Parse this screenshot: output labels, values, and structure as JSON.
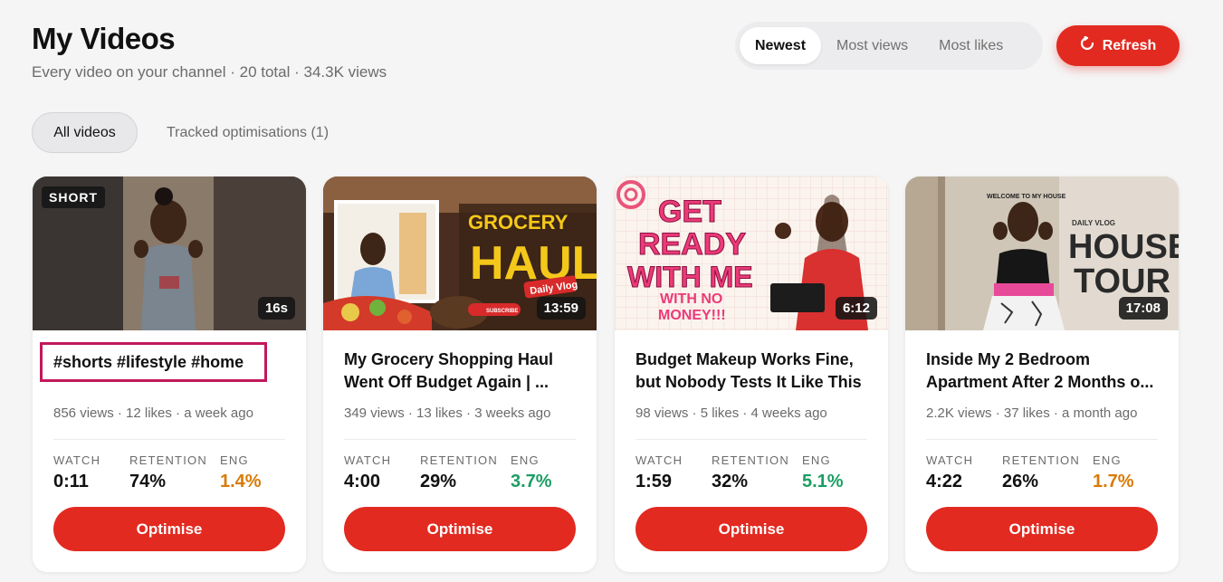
{
  "header": {
    "title": "My Videos",
    "subtitle": "Every video on your channel · 20 total · 34.3K views"
  },
  "sort": {
    "options": [
      "Newest",
      "Most views",
      "Most likes"
    ],
    "selected": "Newest"
  },
  "refresh": {
    "label": "Refresh",
    "icon": "refresh-icon"
  },
  "tabs": [
    {
      "label": "All videos",
      "active": true
    },
    {
      "label": "Tracked optimisations (1)",
      "active": false
    }
  ],
  "stat_labels": {
    "watch": "WATCH",
    "retention": "RETENTION",
    "eng": "ENG"
  },
  "colors": {
    "accent": "#e22a20",
    "eng_orange": "#d97a06",
    "eng_green": "#1a9e63",
    "highlight_border": "#c2185b"
  },
  "videos": [
    {
      "badge": "SHORT",
      "duration": "16s",
      "title": "#shorts #lifestyle #home",
      "meta": "856 views · 12 likes · a week ago",
      "watch": "0:11",
      "retention": "74%",
      "eng": "1.4%",
      "eng_color": "orange",
      "action": "Optimise"
    },
    {
      "badge": "",
      "thumb_text": [
        "GROCERY",
        "HAUL",
        "Daily Vlog",
        "SUBSCRIBE"
      ],
      "duration": "13:59",
      "title": "My Grocery Shopping Haul Went Off Budget Again | ...",
      "meta": "349 views · 13 likes · 3 weeks ago",
      "watch": "4:00",
      "retention": "29%",
      "eng": "3.7%",
      "eng_color": "green",
      "action": "Optimise"
    },
    {
      "badge": "",
      "thumb_text": [
        "GET",
        "READY",
        "WITH ME",
        "WITH NO",
        "MONEY!!!"
      ],
      "duration": "6:12",
      "title": "Budget Makeup Works Fine, but Nobody Tests It Like This",
      "meta": "98 views · 5 likes · 4 weeks ago",
      "watch": "1:59",
      "retention": "32%",
      "eng": "5.1%",
      "eng_color": "green",
      "action": "Optimise"
    },
    {
      "badge": "",
      "thumb_text": [
        "WELCOME TO MY HOUSE",
        "DAILY VLOG",
        "HOUSE",
        "TOUR"
      ],
      "duration": "17:08",
      "title": "Inside My 2 Bedroom Apartment After 2 Months o...",
      "meta": "2.2K views · 37 likes · a month ago",
      "watch": "4:22",
      "retention": "26%",
      "eng": "1.7%",
      "eng_color": "orange",
      "action": "Optimise"
    }
  ]
}
